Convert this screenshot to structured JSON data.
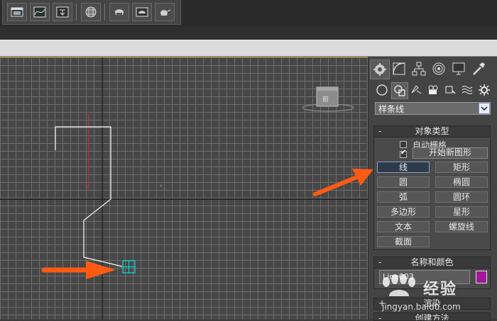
{
  "toolbar": {
    "buttons": [
      {
        "icon": "scene-explorer-icon"
      },
      {
        "icon": "curve-editor-icon"
      },
      {
        "icon": "render-setup-icon"
      },
      {
        "icon": "material-editor-icon"
      },
      {
        "icon": "render-frame-icon"
      },
      {
        "icon": "render-production-icon"
      },
      {
        "icon": "render-iterative-icon"
      }
    ]
  },
  "command_panel": {
    "tabs": [
      {
        "icon": "create-tab-icon",
        "active": true
      },
      {
        "icon": "modify-tab-icon"
      },
      {
        "icon": "hierarchy-tab-icon"
      },
      {
        "icon": "motion-tab-icon"
      },
      {
        "icon": "display-tab-icon"
      },
      {
        "icon": "utilities-tab-icon"
      }
    ],
    "categories": [
      {
        "icon": "geometry-icon"
      },
      {
        "icon": "shapes-icon",
        "active": true
      },
      {
        "icon": "lights-icon"
      },
      {
        "icon": "cameras-icon"
      },
      {
        "icon": "helpers-icon"
      },
      {
        "icon": "space-warps-icon"
      },
      {
        "icon": "systems-icon"
      }
    ],
    "dropdown_value": "样条线",
    "object_type": {
      "sign": "-",
      "title": "对象类型",
      "auto_grid_label": "自动栅格",
      "auto_grid_checked": false,
      "start_new_shape_checked": true,
      "start_new_shape_label": "开始新图形",
      "buttons": [
        "线",
        "矩形",
        "圆",
        "椭圆",
        "弧",
        "圆环",
        "多边形",
        "星形",
        "文本",
        "螺旋线",
        "截面"
      ],
      "active_button": "线"
    },
    "name_color": {
      "sign": "-",
      "title": "名称和颜色",
      "name_value": "Line003",
      "color": "#a0179a"
    },
    "rendering": {
      "sign": "+",
      "title": "渲染"
    },
    "creation_method": {
      "sign": "-",
      "title": "创建方法"
    }
  },
  "colors": {
    "arrow": "#ff5a14",
    "spline": "#ffffff",
    "cursor": "#00e0e0",
    "axis_red": "#c0392b"
  },
  "watermark": {
    "site_cn": "经验",
    "url": "jingyan.baidu.com"
  }
}
